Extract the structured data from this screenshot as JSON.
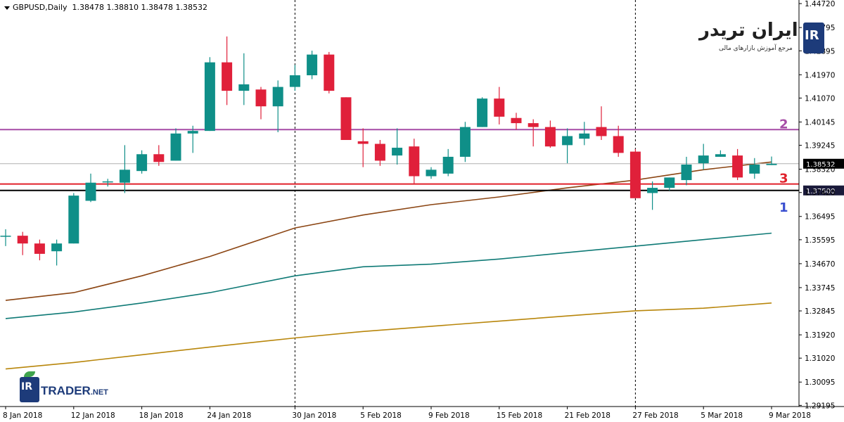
{
  "header": {
    "symbol": "GBPUSD,Daily",
    "ohlc": "1.38478 1.38810 1.38478 1.38532"
  },
  "logos": {
    "top_persian": "ایران تریدر",
    "top_persian_sub": "مرجع آموزش بازارهای مالی",
    "top_ir": "IR",
    "bottom_ir": "IR",
    "bottom_brand": "TRADER",
    "bottom_suffix": ".NET"
  },
  "chart_data": {
    "type": "candlestick",
    "symbol": "GBPUSD",
    "timeframe": "Daily",
    "ylim": [
      1.2915,
      1.4475
    ],
    "y_ticks": [
      "1.44720",
      "1.43795",
      "1.42895",
      "1.41970",
      "1.41070",
      "1.40145",
      "1.39245",
      "1.38320",
      "1.37420",
      "1.36495",
      "1.35595",
      "1.34670",
      "1.33745",
      "1.32845",
      "1.31920",
      "1.31020",
      "1.30095",
      "1.29195"
    ],
    "x_ticks": [
      {
        "index": 0,
        "label": "8 Jan 2018"
      },
      {
        "index": 4,
        "label": "12 Jan 2018"
      },
      {
        "index": 8,
        "label": "18 Jan 2018"
      },
      {
        "index": 12,
        "label": "24 Jan 2018"
      },
      {
        "index": 17,
        "label": "30 Jan 2018"
      },
      {
        "index": 21,
        "label": "5 Feb 2018"
      },
      {
        "index": 25,
        "label": "9 Feb 2018"
      },
      {
        "index": 29,
        "label": "15 Feb 2018"
      },
      {
        "index": 33,
        "label": "21 Feb 2018"
      },
      {
        "index": 37,
        "label": "27 Feb 2018"
      },
      {
        "index": 41,
        "label": "5 Mar 2018"
      },
      {
        "index": 45,
        "label": "9 Mar 2018"
      }
    ],
    "candles": [
      {
        "o": 1.3575,
        "h": 1.36,
        "l": 1.3535,
        "c": 1.3575
      },
      {
        "o": 1.3575,
        "h": 1.359,
        "l": 1.35,
        "c": 1.3545
      },
      {
        "o": 1.3545,
        "h": 1.356,
        "l": 1.348,
        "c": 1.3505
      },
      {
        "o": 1.3515,
        "h": 1.356,
        "l": 1.346,
        "c": 1.3545
      },
      {
        "o": 1.3545,
        "h": 1.374,
        "l": 1.3545,
        "c": 1.373
      },
      {
        "o": 1.371,
        "h": 1.3815,
        "l": 1.3705,
        "c": 1.378
      },
      {
        "o": 1.3785,
        "h": 1.3795,
        "l": 1.3765,
        "c": 1.3785
      },
      {
        "o": 1.378,
        "h": 1.3925,
        "l": 1.374,
        "c": 1.383
      },
      {
        "o": 1.3825,
        "h": 1.3905,
        "l": 1.3815,
        "c": 1.389
      },
      {
        "o": 1.389,
        "h": 1.3925,
        "l": 1.3845,
        "c": 1.386
      },
      {
        "o": 1.3865,
        "h": 1.399,
        "l": 1.3865,
        "c": 1.397
      },
      {
        "o": 1.397,
        "h": 1.4,
        "l": 1.3895,
        "c": 1.398
      },
      {
        "o": 1.398,
        "h": 1.4265,
        "l": 1.398,
        "c": 1.4245
      },
      {
        "o": 1.4245,
        "h": 1.4345,
        "l": 1.408,
        "c": 1.4135
      },
      {
        "o": 1.4135,
        "h": 1.428,
        "l": 1.408,
        "c": 1.416
      },
      {
        "o": 1.414,
        "h": 1.415,
        "l": 1.4025,
        "c": 1.4075
      },
      {
        "o": 1.4075,
        "h": 1.4175,
        "l": 1.3975,
        "c": 1.415
      },
      {
        "o": 1.415,
        "h": 1.4235,
        "l": 1.4135,
        "c": 1.4195
      },
      {
        "o": 1.4195,
        "h": 1.429,
        "l": 1.418,
        "c": 1.4275
      },
      {
        "o": 1.4275,
        "h": 1.4285,
        "l": 1.4125,
        "c": 1.4135
      },
      {
        "o": 1.411,
        "h": 1.411,
        "l": 1.3945,
        "c": 1.3945
      },
      {
        "o": 1.394,
        "h": 1.399,
        "l": 1.384,
        "c": 1.393
      },
      {
        "o": 1.393,
        "h": 1.3945,
        "l": 1.3845,
        "c": 1.3865
      },
      {
        "o": 1.3885,
        "h": 1.399,
        "l": 1.385,
        "c": 1.3915
      },
      {
        "o": 1.392,
        "h": 1.395,
        "l": 1.3775,
        "c": 1.3805
      },
      {
        "o": 1.3805,
        "h": 1.384,
        "l": 1.3795,
        "c": 1.383
      },
      {
        "o": 1.3815,
        "h": 1.391,
        "l": 1.3805,
        "c": 1.388
      },
      {
        "o": 1.388,
        "h": 1.4015,
        "l": 1.386,
        "c": 1.3995
      },
      {
        "o": 1.3995,
        "h": 1.411,
        "l": 1.3995,
        "c": 1.4105
      },
      {
        "o": 1.4105,
        "h": 1.415,
        "l": 1.4005,
        "c": 1.4035
      },
      {
        "o": 1.403,
        "h": 1.405,
        "l": 1.3985,
        "c": 1.401
      },
      {
        "o": 1.401,
        "h": 1.4025,
        "l": 1.392,
        "c": 1.3995
      },
      {
        "o": 1.3995,
        "h": 1.402,
        "l": 1.3915,
        "c": 1.392
      },
      {
        "o": 1.3925,
        "h": 1.399,
        "l": 1.3855,
        "c": 1.396
      },
      {
        "o": 1.395,
        "h": 1.4015,
        "l": 1.3925,
        "c": 1.397
      },
      {
        "o": 1.3995,
        "h": 1.4075,
        "l": 1.3945,
        "c": 1.396
      },
      {
        "o": 1.396,
        "h": 1.4,
        "l": 1.388,
        "c": 1.3895
      },
      {
        "o": 1.39,
        "h": 1.391,
        "l": 1.372,
        "c": 1.372
      },
      {
        "o": 1.374,
        "h": 1.3785,
        "l": 1.3675,
        "c": 1.376
      },
      {
        "o": 1.376,
        "h": 1.38,
        "l": 1.375,
        "c": 1.38
      },
      {
        "o": 1.379,
        "h": 1.388,
        "l": 1.377,
        "c": 1.385
      },
      {
        "o": 1.3855,
        "h": 1.393,
        "l": 1.383,
        "c": 1.3885
      },
      {
        "o": 1.388,
        "h": 1.3905,
        "l": 1.388,
        "c": 1.389
      },
      {
        "o": 1.3885,
        "h": 1.391,
        "l": 1.379,
        "c": 1.38
      },
      {
        "o": 1.3815,
        "h": 1.3875,
        "l": 1.3795,
        "c": 1.385
      },
      {
        "o": 1.3848,
        "h": 1.3881,
        "l": 1.3848,
        "c": 1.3853
      }
    ],
    "moving_averages": [
      {
        "color": "#8b4513",
        "points": [
          [
            0,
            1.3325
          ],
          [
            4,
            1.3355
          ],
          [
            8,
            1.342
          ],
          [
            12,
            1.3495
          ],
          [
            17,
            1.3605
          ],
          [
            21,
            1.3655
          ],
          [
            25,
            1.3695
          ],
          [
            29,
            1.3725
          ],
          [
            33,
            1.376
          ],
          [
            37,
            1.379
          ],
          [
            41,
            1.383
          ],
          [
            45,
            1.386
          ]
        ]
      },
      {
        "color": "#0f7a76",
        "points": [
          [
            0,
            1.3255
          ],
          [
            4,
            1.328
          ],
          [
            8,
            1.3315
          ],
          [
            12,
            1.3355
          ],
          [
            17,
            1.342
          ],
          [
            21,
            1.3455
          ],
          [
            25,
            1.3465
          ],
          [
            29,
            1.3485
          ],
          [
            33,
            1.351
          ],
          [
            37,
            1.3535
          ],
          [
            41,
            1.356
          ],
          [
            45,
            1.3585
          ]
        ]
      },
      {
        "color": "#b8860b",
        "points": [
          [
            0,
            1.306
          ],
          [
            4,
            1.3085
          ],
          [
            8,
            1.3115
          ],
          [
            12,
            1.3145
          ],
          [
            17,
            1.318
          ],
          [
            21,
            1.3205
          ],
          [
            25,
            1.3225
          ],
          [
            29,
            1.3245
          ],
          [
            33,
            1.3265
          ],
          [
            37,
            1.3285
          ],
          [
            41,
            1.3295
          ],
          [
            45,
            1.3315
          ]
        ]
      }
    ],
    "horizontal_lines": [
      {
        "price": 1.3985,
        "color": "#a64ca6",
        "label": "2"
      },
      {
        "price": 1.3775,
        "color": "#e0202a",
        "label": "3"
      },
      {
        "price": 1.375,
        "color": "#000000",
        "label": "1",
        "price_label": "1.37500"
      }
    ],
    "current_price": {
      "price": 1.38532,
      "label": "1.38532"
    },
    "vertical_separators": [
      17,
      37
    ],
    "colors": {
      "bull": "#0f8f88",
      "bear": "#e0203a",
      "wick": "#555555"
    },
    "grid": false
  }
}
